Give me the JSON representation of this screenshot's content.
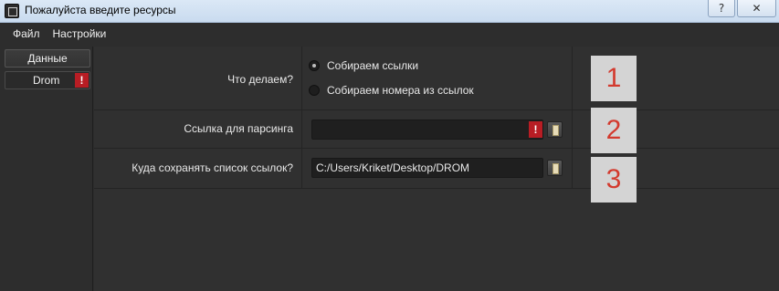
{
  "window": {
    "title": "Пожалуйста введите ресурсы",
    "help_label": "?",
    "close_label": "✕"
  },
  "menu": [
    "Файл",
    "Настройки"
  ],
  "sidebar": {
    "items": [
      {
        "label": "Данные"
      },
      {
        "label": "Drom",
        "warning": "!"
      }
    ]
  },
  "form": {
    "action": {
      "label": "Что делаем?",
      "options": [
        "Собираем ссылки",
        "Собираем номера из ссылок"
      ],
      "selected_index": 0
    },
    "link": {
      "label": "Ссылка для парсинга",
      "value": "",
      "warning": "!"
    },
    "save_path": {
      "label": "Куда сохранять список ссылок?",
      "value": "C:/Users/Kriket/Desktop/DROM"
    }
  },
  "annotations": [
    "1",
    "2",
    "3"
  ],
  "colors": {
    "background": "#2d2d2d",
    "warning": "#b81d24",
    "annotation_text": "#d33a2e",
    "annotation_bg": "#d4d4d4"
  }
}
